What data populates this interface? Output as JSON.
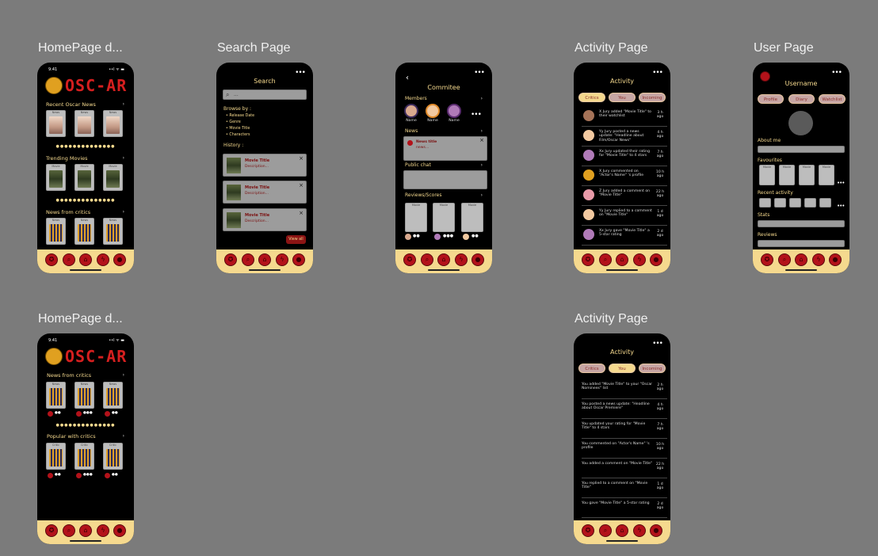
{
  "frames": {
    "home1": "HomePage d...",
    "search": "Search Page",
    "activity1": "Activity Page",
    "user": "User Page",
    "home2": "HomePage d...",
    "activity2": "Activity Page"
  },
  "status_time": "9:41",
  "status_icons": "••l ᯤ ▬",
  "tabbar": {
    "icons": [
      "awards-icon",
      "search-icon",
      "home-icon",
      "activity-icon",
      "user-icon"
    ],
    "glyphs": [
      "✪",
      "⌕",
      "⌂",
      "ϟ",
      "●"
    ]
  },
  "logo_text": "OSC-AR",
  "home1": {
    "sections": [
      "Recent Oscar News",
      "Trending Movies",
      "News from critics"
    ],
    "card_labels": {
      "news": "News",
      "movie": "Movie"
    },
    "dots": "●●●●●●●●●●●●●●",
    "more": "›"
  },
  "home2": {
    "sections": [
      "News from critics",
      "Popular with critics"
    ],
    "card_labels": {
      "news": "News",
      "critic": "Critic"
    },
    "ratings": [
      "●●",
      "●●●",
      "●●"
    ],
    "dots": "●●●●●●●●●●●●●●"
  },
  "search": {
    "title": "Search",
    "placeholder": "...",
    "browse_title": "Browse by :",
    "browse": [
      "Release Date",
      "Genre",
      "Movie Title",
      "Characters"
    ],
    "history_title": "History :",
    "history_item_title": "Movie Title",
    "history_item_desc": "Description...",
    "view_all": "View all"
  },
  "committee": {
    "title": "Commitee",
    "members_title": "Members",
    "member_name": "Name",
    "news_title": "News",
    "news_item_title": "News title",
    "news_item_desc": "news...",
    "public_chat": "Public chat",
    "reviews_title": "Reviews/Scores",
    "review_card_label": "Movie",
    "ratings": [
      "●●",
      "●●●",
      "●●"
    ]
  },
  "activity": {
    "title": "Activity",
    "tabs": [
      "Critics",
      "You",
      "Incoming"
    ],
    "critics_items": [
      {
        "msg": "X Jury added \"Movie Title\" to their watchlist",
        "when": "3 h ago"
      },
      {
        "msg": "Yy Jury posted a news update: \"Headline about Film/Oscar News\"",
        "when": "4 h ago"
      },
      {
        "msg": "Xx Jury updated their rating for \"Movie Title\" to 4 stars",
        "when": "7 h ago"
      },
      {
        "msg": "X Jury commented on \"Actor's Name\" 's profile",
        "when": "10 h ago"
      },
      {
        "msg": "Z Jury added a comment on \"Movie Title\"",
        "when": "22 h ago"
      },
      {
        "msg": "Yy Jury replied to a comment on \"Movie Title\"",
        "when": "1 d ago"
      },
      {
        "msg": "Xx Jury gave \"Movie Title\" a 5-star rating",
        "when": "2 d ago"
      }
    ],
    "you_items": [
      {
        "msg": "You added \"Movie Title\" to your \"Oscar Nominees\" list",
        "when": "2 h ago"
      },
      {
        "msg": "You posted a news update: \"Headline about Oscar Premiere\"",
        "when": "4 h ago"
      },
      {
        "msg": "You updated your rating for \"Movie Title\" to 4 stars",
        "when": "7 h ago"
      },
      {
        "msg": "You commented on \"Actor's Name\" 's profile",
        "when": "10 h ago"
      },
      {
        "msg": "You added a comment on \"Movie Title\"",
        "when": "22 h ago"
      },
      {
        "msg": "You replied to a comment on \"Movie Title\"",
        "when": "1 d ago"
      },
      {
        "msg": "You gave \"Movie Title\" a 5-star rating",
        "when": "2 d ago"
      }
    ]
  },
  "user": {
    "username": "Username",
    "tabs": [
      "Profile",
      "Diary",
      "Watchlist"
    ],
    "about": "About me",
    "favourites": "Favourites",
    "fav_card_label": "Movie",
    "recent": "Recent activity",
    "stats": "Stats",
    "reviews": "Reviews"
  },
  "more_glyph": "•••",
  "back_glyph": "‹",
  "close_glyph": "×"
}
